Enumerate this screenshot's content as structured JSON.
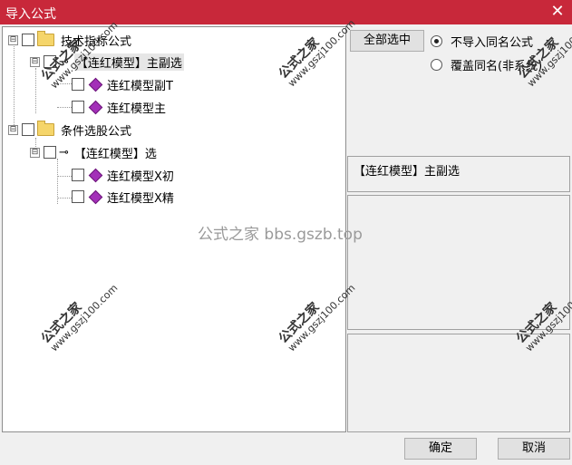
{
  "window": {
    "title": "导入公式",
    "close_glyph": "✕"
  },
  "tree": {
    "groups": [
      {
        "label": "技术指标公式",
        "expander": "⊟"
      },
      {
        "label": "条件选股公式",
        "expander": "⊟"
      }
    ],
    "subgroup1": {
      "label": "【连红模型】主副选",
      "expander": "⊟"
    },
    "subgroup2": {
      "label": "【连红模型】选",
      "expander": "⊟"
    },
    "items": [
      "连红模型副T",
      "连红模型主",
      "连红模型X初",
      "连红模型X精"
    ]
  },
  "right": {
    "select_all": "全部选中",
    "radio1": "不导入同名公式",
    "radio2": "覆盖同名(非系统)",
    "info_text": "【连红模型】主副选"
  },
  "footer": {
    "ok": "确定",
    "cancel": "取消"
  },
  "watermark": {
    "brand": "公式之家",
    "url": "www.gszj100.com",
    "center": "公式之家 bbs.gszb.top"
  }
}
